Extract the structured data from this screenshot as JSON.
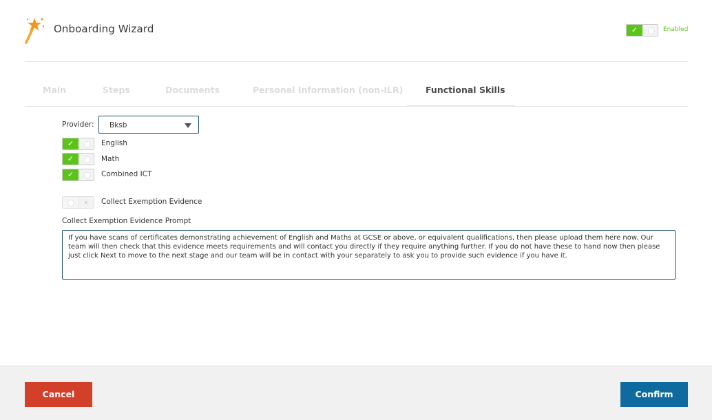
{
  "header": {
    "title": "Onboarding Wizard",
    "enabled_label": "Enabled",
    "enabled_check": "✓",
    "icon": "magic-wand-icon"
  },
  "tabs": [
    {
      "label": "Main"
    },
    {
      "label": "Steps"
    },
    {
      "label": "Documents"
    },
    {
      "label": "Personal Information (non-ILR)"
    },
    {
      "label": "Functional Skills"
    }
  ],
  "form": {
    "provider_label": "Provider:",
    "provider_value": "Bksb",
    "skills": [
      {
        "label": "English",
        "check": "✓"
      },
      {
        "label": "Math",
        "check": "✓"
      },
      {
        "label": "Combined ICT",
        "check": "✓"
      }
    ],
    "exemption_label": "Collect Exemption Evidence",
    "prompt_label": "Collect Exemption Evidence Prompt",
    "prompt_text": "If you have scans of certificates demonstrating achievement of English and Maths at GCSE or above, or equivalent qualifications, then please upload them here now. Our team will then check that this evidence meets requirements and will contact you directly if they require anything further. If you do not have these to hand now then please just click Next to move to the next stage and our team will be in contact with your separately to ask you to provide such evidence if you have it."
  },
  "footer": {
    "cancel_label": "Cancel",
    "confirm_label": "Confirm"
  },
  "colors": {
    "toggle_on": "#5cc319",
    "cancel": "#d3402a",
    "confirm": "#0f6b9f",
    "input_border": "#1f4e6e"
  }
}
